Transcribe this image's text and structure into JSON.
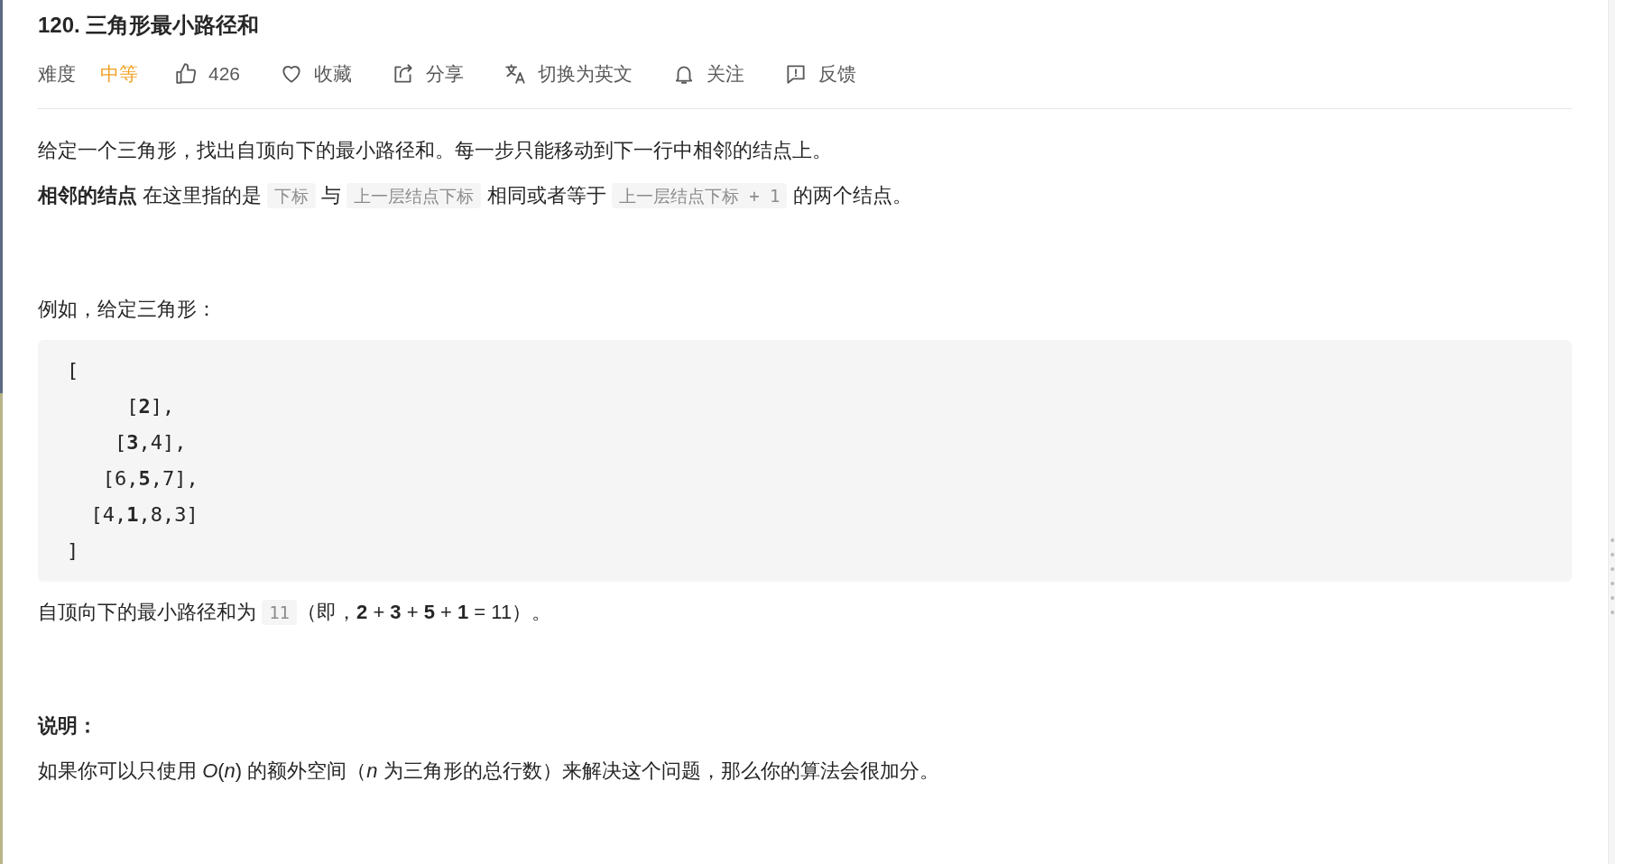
{
  "title": "120. 三角形最小路径和",
  "difficulty": {
    "label": "难度",
    "value": "中等"
  },
  "actions": [
    {
      "kind": "like",
      "label": "426"
    },
    {
      "kind": "favorite",
      "label": "收藏"
    },
    {
      "kind": "share",
      "label": "分享"
    },
    {
      "kind": "translate",
      "label": "切换为英文"
    },
    {
      "kind": "follow",
      "label": "关注"
    },
    {
      "kind": "feedback",
      "label": "反馈"
    }
  ],
  "content": [
    {
      "kind": "paragraph",
      "parts": [
        {
          "kind": "text",
          "text": "给定一个三角形，找出自顶向下的最小路径和。每一步只能移动到下一行中相邻的结点上。"
        }
      ]
    },
    {
      "kind": "paragraph",
      "parts": [
        {
          "kind": "bold",
          "text": "相邻的结点"
        },
        {
          "kind": "text",
          "text": " 在这里指的是 "
        },
        {
          "kind": "code",
          "text": "下标"
        },
        {
          "kind": "text",
          "text": " 与 "
        },
        {
          "kind": "code",
          "text": "上一层结点下标"
        },
        {
          "kind": "text",
          "text": " 相同或者等于 "
        },
        {
          "kind": "code",
          "text": "上一层结点下标 + 1"
        },
        {
          "kind": "text",
          "text": " 的两个结点。"
        }
      ]
    },
    {
      "kind": "spacer"
    },
    {
      "kind": "paragraph",
      "parts": [
        {
          "kind": "text",
          "text": "例如，给定三角形："
        }
      ]
    },
    {
      "kind": "codeblock",
      "lines": [
        "[",
        "     [**2**],",
        "    [**3**,4],",
        "   [6,**5**,7],",
        "  [4,**1**,8,3]",
        "]"
      ]
    },
    {
      "kind": "paragraph",
      "parts": [
        {
          "kind": "text",
          "text": "自顶向下的最小路径和为 "
        },
        {
          "kind": "code",
          "text": "11"
        },
        {
          "kind": "text",
          "text": "（即，**2** + **3** + **5** + **1** = 11）。"
        }
      ]
    },
    {
      "kind": "spacer"
    },
    {
      "kind": "paragraph",
      "parts": [
        {
          "kind": "bold",
          "text": "说明："
        }
      ]
    },
    {
      "kind": "paragraph",
      "parts": [
        {
          "kind": "text",
          "text": "如果你可以只使用 *O*(*n*) 的额外空间（*n* 为三角形的总行数）来解决这个问题，那么你的算法会很加分。"
        }
      ]
    }
  ]
}
